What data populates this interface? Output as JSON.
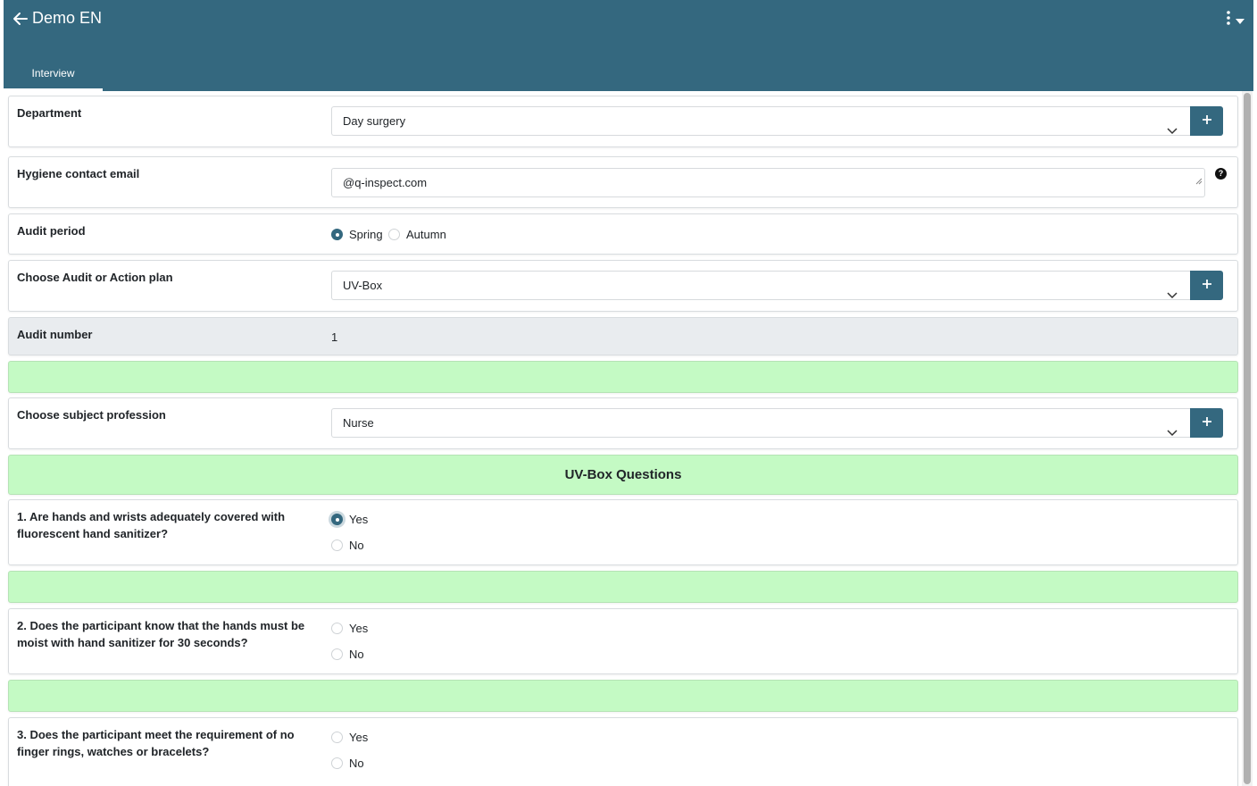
{
  "header": {
    "title": "Demo EN",
    "tab": "Interview"
  },
  "form": {
    "department": {
      "label": "Department",
      "value": "Day surgery"
    },
    "hygiene_email": {
      "label": "Hygiene contact email",
      "value": "@q-inspect.com"
    },
    "audit_period": {
      "label": "Audit period",
      "options": [
        "Spring",
        "Autumn"
      ],
      "selected": "Spring"
    },
    "audit_choice": {
      "label": "Choose Audit or Action plan",
      "value": "UV-Box"
    },
    "audit_number": {
      "label": "Audit number",
      "value": "1"
    },
    "profession": {
      "label": "Choose subject profession",
      "value": "Nurse"
    },
    "section_title": "UV-Box Questions",
    "questions": [
      {
        "text": "1. Are hands and wrists adequately covered with fluorescent hand sanitizer?",
        "yes": "Yes",
        "no": "No",
        "selected": "Yes"
      },
      {
        "text": "2. Does the participant know that the hands must be moist with hand sanitizer for 30 seconds?",
        "yes": "Yes",
        "no": "No",
        "selected": ""
      },
      {
        "text": "3. Does the participant meet the requirement of no finger rings, watches or bracelets?",
        "yes": "Yes",
        "no": "No",
        "selected": ""
      }
    ]
  },
  "colors": {
    "primary": "#34687f",
    "green_band": "#c4fac4",
    "readonly_bg": "#e9ecef"
  },
  "icons": [
    "arrow-left-icon",
    "kebab-menu-icon",
    "caret-down-icon",
    "chevron-down-icon",
    "plus-icon",
    "help-icon",
    "resize-grip-icon"
  ]
}
